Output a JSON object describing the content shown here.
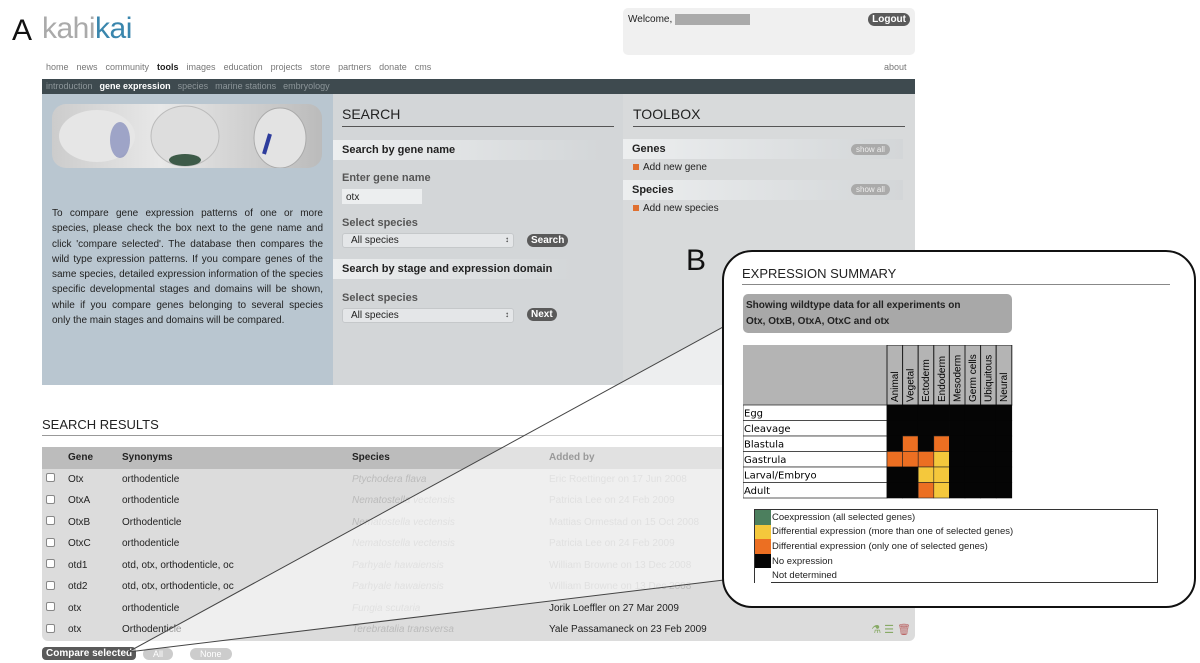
{
  "figure": {
    "panel_a": "A",
    "panel_b": "B"
  },
  "logo": {
    "part1": "kahi",
    "part2": "kai"
  },
  "header": {
    "welcome": "Welcome,",
    "logout": "Logout",
    "about": "about"
  },
  "nav": {
    "items": [
      "home",
      "news",
      "community",
      "tools",
      "images",
      "education",
      "projects",
      "store",
      "partners",
      "donate",
      "cms"
    ],
    "active": "tools"
  },
  "subnav": {
    "items": [
      "introduction",
      "gene expression",
      "species",
      "marine stations",
      "embryology"
    ],
    "active": "gene expression"
  },
  "intro": "To compare gene expression patterns of one or more species, please check the box next to the gene name and click 'compare selected'. The database then compares the wild type expression patterns. If you compare genes of the same species, detailed expression information of the species specific developmental stages and domains will be shown, while if you compare genes belonging to several species only the main stages and domains will be compared.",
  "search": {
    "title": "SEARCH",
    "by_gene": "Search by gene name",
    "enter_label": "Enter gene name",
    "gene_value": "otx",
    "select_label": "Select species",
    "species_value": "All species",
    "search_button": "Search",
    "by_stage": "Search by stage and expression domain",
    "select_label2": "Select species",
    "species_value2": "All species",
    "next_button": "Next"
  },
  "toolbox": {
    "title": "TOOLBOX",
    "genes": "Genes",
    "add_gene": "Add new gene",
    "species": "Species",
    "add_species": "Add new species",
    "show_all": "show all"
  },
  "results": {
    "title": "SEARCH RESULTS",
    "columns": [
      "Gene",
      "Synonyms",
      "Species",
      "Added by"
    ],
    "rows": [
      {
        "gene": "Otx",
        "synonyms": "orthodenticle",
        "species": "Ptychodera flava",
        "added": "Eric Roettinger on 17 Jun 2008"
      },
      {
        "gene": "OtxA",
        "synonyms": "orthodenticle",
        "species": "Nematostella vectensis",
        "added": "Patricia Lee on 24 Feb 2009"
      },
      {
        "gene": "OtxB",
        "synonyms": "Orthodenticle",
        "species": "Nematostella vectensis",
        "added": "Mattias Ormestad on 15 Oct 2008"
      },
      {
        "gene": "OtxC",
        "synonyms": "orthodenticle",
        "species": "Nematostella vectensis",
        "added": "Patricia Lee on 24 Feb 2009"
      },
      {
        "gene": "otd1",
        "synonyms": "otd, otx, orthodenticle, oc",
        "species": "Parhyale hawaiensis",
        "added": "William Browne on 13 Dec 2008"
      },
      {
        "gene": "otd2",
        "synonyms": "otd, otx, orthodenticle, oc",
        "species": "Parhyale hawaiensis",
        "added": "William Browne on 13 Dec 2008"
      },
      {
        "gene": "otx",
        "synonyms": "orthodenticle",
        "species": "Fungia scutaria",
        "added": "Jorik Loeffler on 27 Mar 2009"
      },
      {
        "gene": "otx",
        "synonyms": "Orthodenticle",
        "species": "Terebratalia transversa",
        "added": "Yale Passamaneck on 23 Feb 2009"
      }
    ],
    "compare_button": "Compare selected",
    "all_button": "All",
    "none_button": "None"
  },
  "summary": {
    "title": "EXPRESSION SUMMARY",
    "showing_line1": "Showing wildtype data for all experiments on",
    "showing_line2": "Otx, OtxB, OtxA, OtxC and otx",
    "domains": [
      "Animal",
      "Vegetal",
      "Ectoderm",
      "Endoderm",
      "Mesoderm",
      "Germ cells",
      "Ubiquitous",
      "Neural"
    ],
    "stages": [
      "Egg",
      "Cleavage",
      "Blastula",
      "Gastrula",
      "Larval/Embryo",
      "Adult"
    ],
    "matrix": [
      [
        "none",
        "none",
        "none",
        "none",
        "none",
        "none",
        "none",
        "none"
      ],
      [
        "none",
        "none",
        "none",
        "none",
        "none",
        "none",
        "none",
        "none"
      ],
      [
        "none",
        "one",
        "none",
        "one",
        "none",
        "none",
        "none",
        "none"
      ],
      [
        "one",
        "one",
        "one",
        "multi",
        "none",
        "none",
        "none",
        "none"
      ],
      [
        "none",
        "none",
        "multi",
        "multi",
        "none",
        "none",
        "none",
        "none"
      ],
      [
        "none",
        "none",
        "one",
        "multi",
        "none",
        "none",
        "none",
        "none"
      ]
    ],
    "legend": [
      {
        "key": "co",
        "label": "Coexpression (all selected genes)",
        "color": "#4c7f5e"
      },
      {
        "key": "multi",
        "label": "Differential expression (more than one of selected genes)",
        "color": "#f4c83c"
      },
      {
        "key": "one",
        "label": "Differential expression (only one of selected genes)",
        "color": "#ec6f22"
      },
      {
        "key": "none",
        "label": "No expression",
        "color": "#050505"
      },
      {
        "key": "nd",
        "label": "Not determined",
        "color": "#ffffff"
      }
    ]
  }
}
